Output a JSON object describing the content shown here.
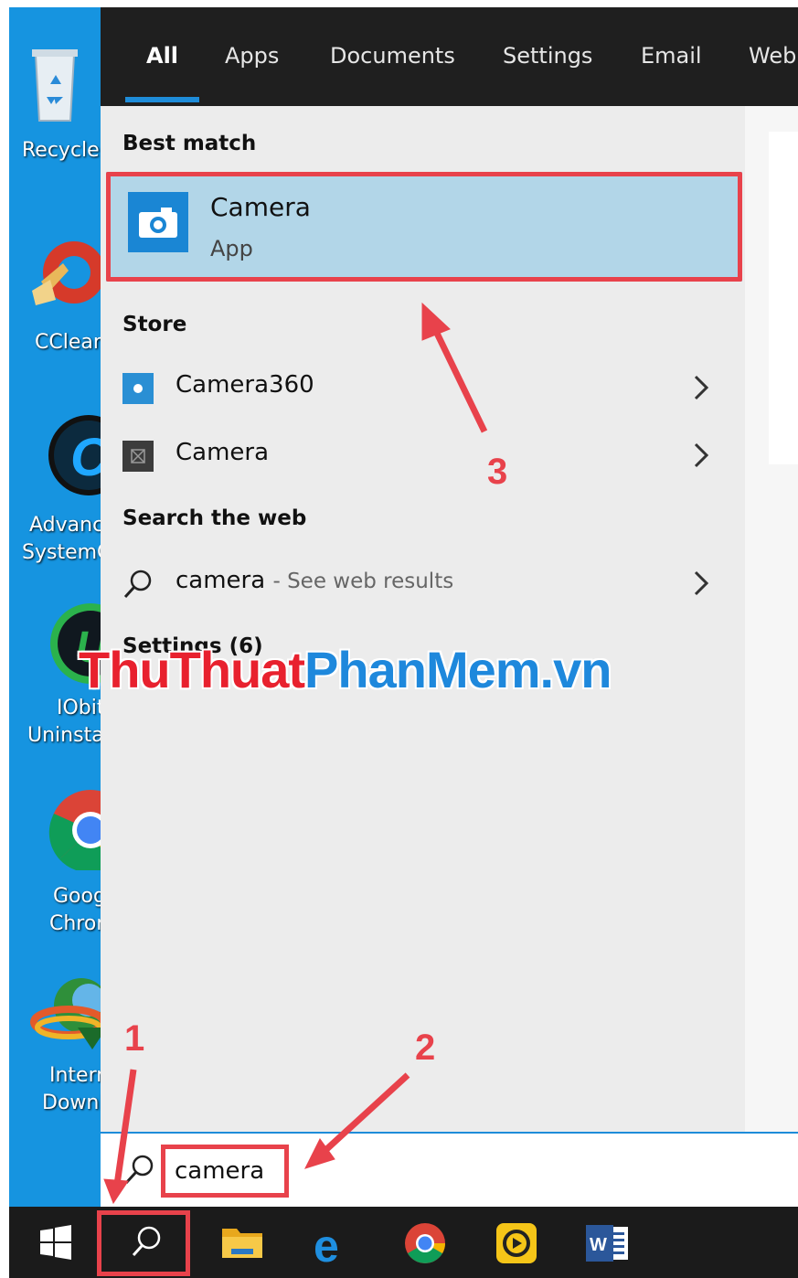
{
  "desktop": {
    "icons": [
      {
        "name": "recycle-bin",
        "label_lines": [
          "Recycle"
        ]
      },
      {
        "name": "ccleaner",
        "label_lines": [
          "CClear"
        ]
      },
      {
        "name": "advanced-systemcare",
        "label_lines": [
          "Advanc",
          "SystemC"
        ]
      },
      {
        "name": "iobit-uninstaller",
        "label_lines": [
          "IObit",
          "Uninsta"
        ]
      },
      {
        "name": "google-chrome",
        "label_lines": [
          "Googl",
          "Chron"
        ]
      },
      {
        "name": "internet-download-manager",
        "label_lines": [
          "Intern",
          "Downl"
        ]
      }
    ]
  },
  "tabs": [
    "All",
    "Apps",
    "Documents",
    "Settings",
    "Email",
    "Web"
  ],
  "active_tab": "All",
  "sections": {
    "best_match": "Best match",
    "store": "Store",
    "web": "Search the web",
    "settings": "Settings (6)"
  },
  "best_match": {
    "name": "Camera",
    "type": "App",
    "icon": "camera-icon"
  },
  "store_items": [
    {
      "label": "Camera360",
      "icon": "camera360-icon"
    },
    {
      "label": "Camera",
      "icon": "camera-store-icon"
    }
  ],
  "web_result": {
    "query": "camera",
    "suffix": "- See web results",
    "icon": "search-icon"
  },
  "search": {
    "value": "camera"
  },
  "taskbar": {
    "items": [
      "start-icon",
      "search-icon",
      "file-explorer-icon",
      "edge-icon",
      "chrome-icon",
      "ldplayer-icon",
      "word-icon"
    ]
  },
  "annotations": {
    "n1": "1",
    "n2": "2",
    "n3": "3"
  },
  "watermark": {
    "part1": "ThuThuat",
    "part2": "PhanMem.vn"
  },
  "colors": {
    "accent": "#1e8cd9",
    "highlight": "#e8424b",
    "selection": "#b2d6e8"
  }
}
